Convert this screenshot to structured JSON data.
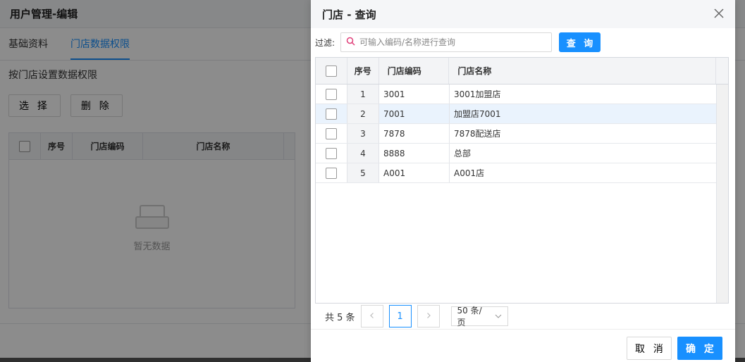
{
  "background": {
    "title": "用户管理-编辑",
    "tabs": [
      {
        "label": "基础资料"
      },
      {
        "label": "门店数据权限"
      }
    ],
    "subtitle": "按门店设置数据权限",
    "buttons": {
      "select": "选 择",
      "delete": "删 除"
    },
    "table": {
      "columns": [
        "序号",
        "门店编码",
        "门店名称"
      ],
      "empty_text": "暂无数据"
    }
  },
  "dialog": {
    "title": "门店 - 查询",
    "filter_label": "过滤:",
    "search_placeholder": "可输入编码/名称进行查询",
    "query_button": "查 询",
    "columns": {
      "index": "序号",
      "code": "门店编码",
      "name": "门店名称"
    },
    "rows": [
      {
        "index": "1",
        "code": "3001",
        "name": "3001加盟店",
        "selected": false
      },
      {
        "index": "2",
        "code": "7001",
        "name": "加盟店7001",
        "selected": true
      },
      {
        "index": "3",
        "code": "7878",
        "name": "7878配送店",
        "selected": false
      },
      {
        "index": "4",
        "code": "8888",
        "name": "总部",
        "selected": false
      },
      {
        "index": "5",
        "code": "A001",
        "name": "A001店",
        "selected": false
      }
    ],
    "pager": {
      "total_text": "共 5 条",
      "prev": "<",
      "current_page": "1",
      "next": ">",
      "page_size": "50 条/页"
    },
    "footer": {
      "cancel": "取 消",
      "ok": "确 定"
    }
  },
  "colors": {
    "accent": "#1890ff",
    "overlay": "rgba(0,0,0,0.45)"
  }
}
